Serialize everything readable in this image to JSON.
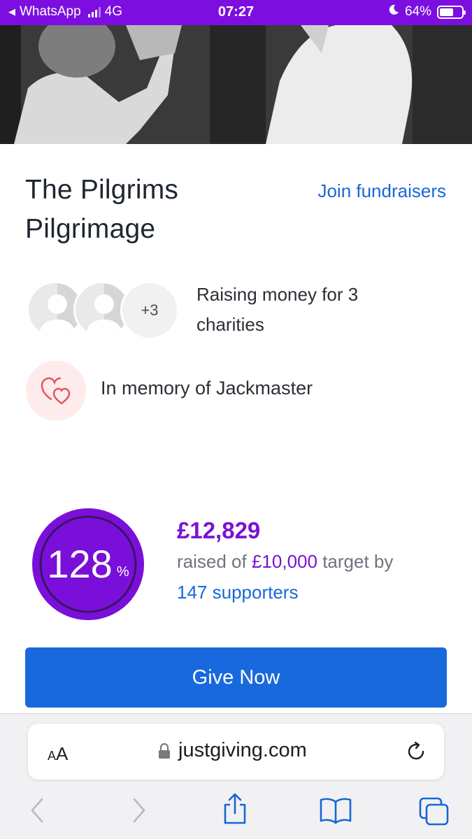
{
  "status_bar": {
    "back_app": "WhatsApp",
    "network": "4G",
    "time": "07:27",
    "battery": "64%",
    "battery_level": 0.64
  },
  "fundraiser": {
    "title": "The Pilgrims Pilgrimage",
    "join_link": "Join fundraisers",
    "avatars_more": "+3",
    "charity_text": "Raising money for 3 charities",
    "memory_text": "In memory of Jackmaster"
  },
  "progress": {
    "percent": "128",
    "percent_sign": "%",
    "percent_value": 1.28,
    "raised": "£12,829",
    "raised_prefix": "raised of",
    "target": "£10,000",
    "target_suffix": "target by",
    "supporters": "147 supporters"
  },
  "give_button": "Give Now",
  "browser": {
    "aa_small": "A",
    "aa_big": "A",
    "url": "justgiving.com"
  },
  "icons": {
    "back": "chevron-left-icon",
    "forward": "chevron-right-icon",
    "share": "share-icon",
    "bookmarks": "book-icon",
    "tabs": "tabs-icon",
    "reload": "reload-icon",
    "lock": "lock-icon",
    "memory": "hearts-icon",
    "moon": "moon-icon"
  },
  "colors": {
    "status_bar": "#7c0fe0",
    "accent_purple": "#7a12d6",
    "link_blue": "#1868d6",
    "button_blue": "#1869de"
  }
}
